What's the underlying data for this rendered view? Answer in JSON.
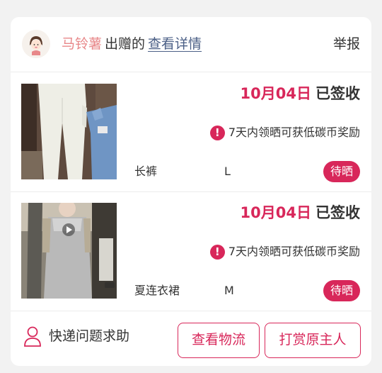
{
  "donation": {
    "donor_name": "马铃薯",
    "verb": "出赠的",
    "details_link": "查看详情",
    "report_label": "举报"
  },
  "items": [
    {
      "date": "10月04日",
      "status": "已签收",
      "notice_icon": "exclamation-icon",
      "notice": "7天内领晒可获低碳币奖励",
      "name": "长裤",
      "size": "L",
      "badge": "待晒"
    },
    {
      "date": "10月04日",
      "status": "已签收",
      "notice_icon": "exclamation-icon",
      "notice": "7天内领晒可获低碳币奖励",
      "name": "夏连衣裙",
      "size": "M",
      "badge": "待晒"
    }
  ],
  "footer": {
    "help_icon": "user-icon",
    "help_label": "快递问题求助",
    "logistics_button": "查看物流",
    "reward_button": "打赏原主人"
  },
  "colors": {
    "accent": "#d8275a",
    "donor_name": "#e8888a",
    "link": "#4b5f86",
    "text": "#333333",
    "background": "#f2f2f2"
  }
}
